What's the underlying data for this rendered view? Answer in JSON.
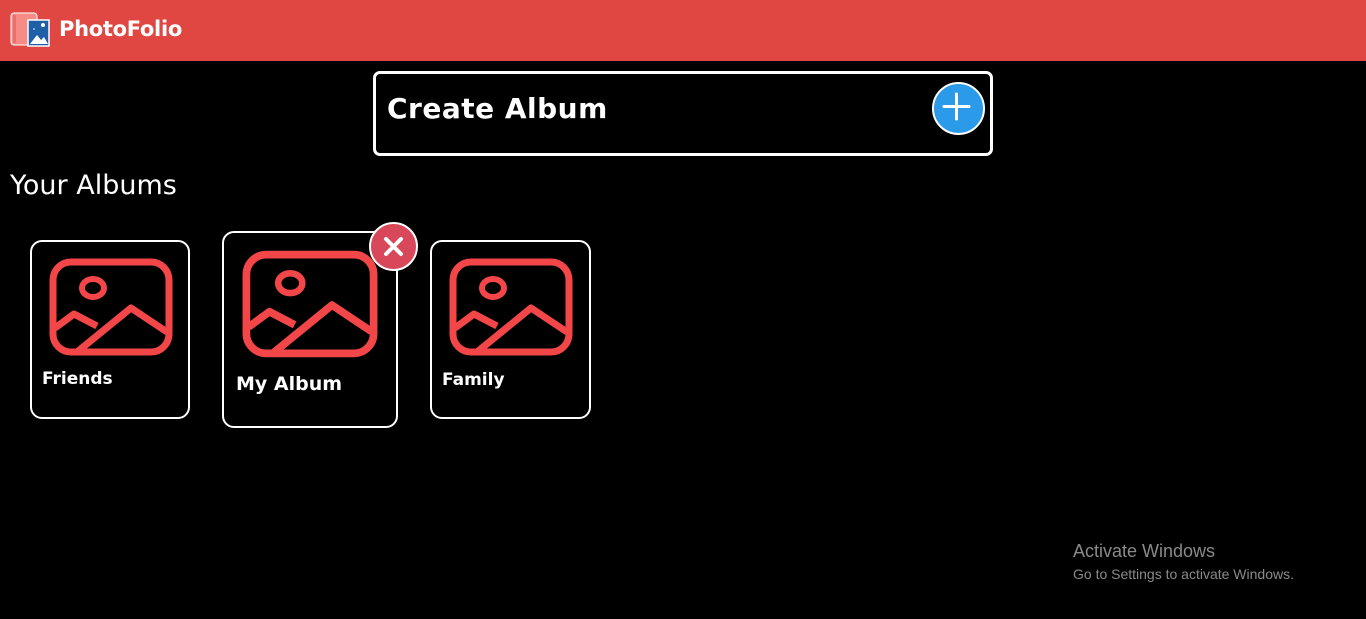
{
  "app": {
    "name": "PhotoFolio",
    "brand_color": "#e04743",
    "logo_icon": "photo-album-icon"
  },
  "create_album": {
    "label": "Create Album",
    "add_icon": "plus-icon",
    "add_color": "#2b9ae8"
  },
  "albums_section": {
    "title": "Your Albums",
    "icon": "image-icon",
    "icon_color": "#f24648",
    "items": [
      {
        "name": "Friends"
      },
      {
        "name": "My Album",
        "hovered": true,
        "delete_icon": "close-icon"
      },
      {
        "name": "Family"
      }
    ]
  },
  "os_watermark": {
    "title": "Activate Windows",
    "subtitle": "Go to Settings to activate Windows."
  }
}
